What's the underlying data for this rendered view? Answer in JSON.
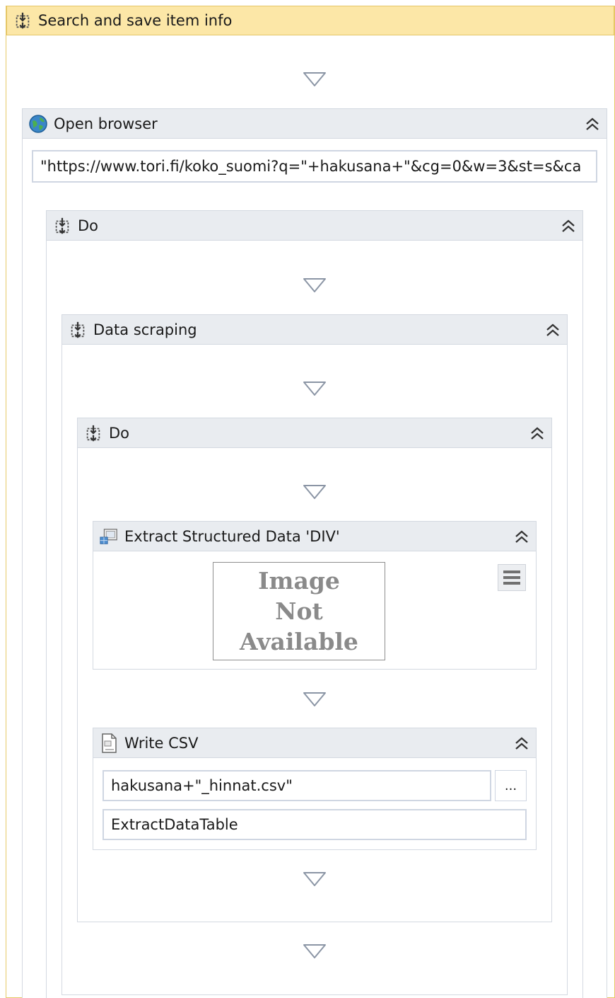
{
  "outer_sequence": {
    "title": "Search and save item info"
  },
  "open_browser": {
    "title": "Open browser",
    "url_value": "\"https://www.tori.fi/koko_suomi?q=\"+hakusana+\"&cg=0&w=3&st=s&ca"
  },
  "do_outer": {
    "title": "Do"
  },
  "data_scraping": {
    "title": "Data scraping"
  },
  "do_inner": {
    "title": "Do"
  },
  "extract_structured_data": {
    "title": "Extract Structured Data 'DIV'",
    "image_placeholder": [
      "Image",
      "Not",
      "Available"
    ]
  },
  "write_csv": {
    "title": "Write CSV",
    "file_path_value": "hakusana+\"_hinnat.csv\"",
    "browse_label": "...",
    "datatable_value": "ExtractDataTable"
  },
  "colors": {
    "outer_header": "#fce7a7",
    "activity_header": "#e9ecf0",
    "border": "#d4d9e1"
  }
}
